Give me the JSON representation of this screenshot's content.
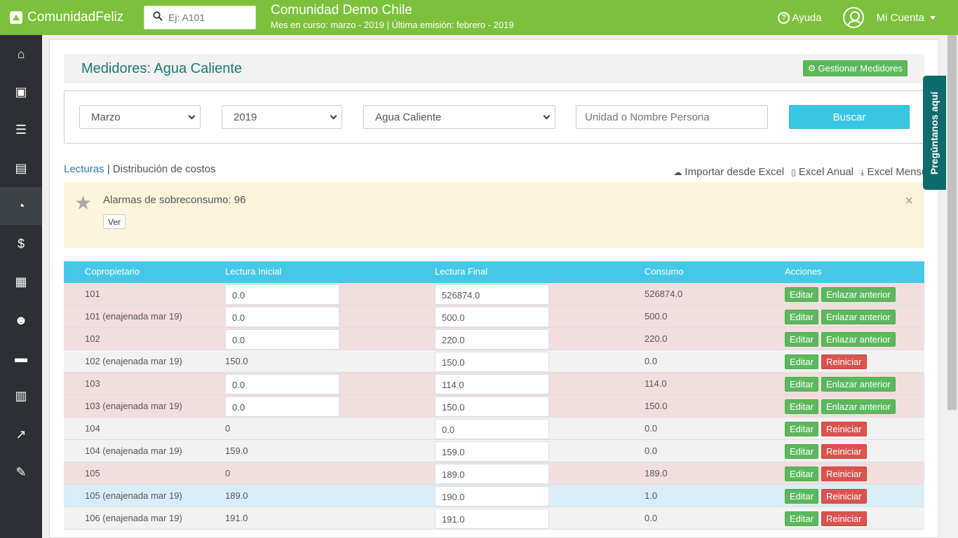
{
  "header": {
    "logo": "ComunidadFeliz",
    "search_placeholder": "Ej: A101",
    "community_name": "Comunidad Demo Chile",
    "community_sub": "Mes en curso: marzo - 2019 | Última emisión: febrero - 2019",
    "help": "Ayuda",
    "account": "Mi Cuenta"
  },
  "sidebar": {
    "icons": [
      "home-icon",
      "money-icon",
      "document-icon",
      "book-icon",
      "dashboard-icon",
      "dollar-icon",
      "calculator-icon",
      "users-icon",
      "briefcase-icon",
      "building-icon",
      "chart-icon",
      "wrench-icon"
    ],
    "glyphs": [
      "⌂",
      "▣",
      "☰",
      "▤",
      "◔",
      "$",
      "▦",
      "☻",
      "▬",
      "▥",
      "↗",
      "✎"
    ]
  },
  "page": {
    "title": "Medidores: Agua Caliente",
    "manage_button": "Gestionar Medidores"
  },
  "filters": {
    "month": "Marzo",
    "year": "2019",
    "type": "Agua Caliente",
    "person_placeholder": "Unidad o Nombre Persona",
    "search_button": "Buscar"
  },
  "tabs": {
    "lecturas": "Lecturas",
    "separator": " | ",
    "distribucion": "Distribución de costos"
  },
  "actions": {
    "import": "Importar desde Excel",
    "excel_anual": "Excel Anual",
    "excel_mensual": "Excel Mensual"
  },
  "alert": {
    "message": "Alarmas de sobreconsumo: 96",
    "button": "Ver",
    "close": "×"
  },
  "table": {
    "headers": [
      "Copropietario",
      "Lectura Inicial",
      "Lectura Final",
      "Consumo",
      "Acciones"
    ],
    "edit_label": "Editar",
    "link_label": "Enlazar anterior",
    "reset_label": "Reiniciar",
    "rows": [
      {
        "owner": "101",
        "initial": "0.0",
        "final": "526874.0",
        "consumo": "526874.0"
      },
      {
        "owner": "101 (enajenada mar 19)",
        "initial": "0.0",
        "final": "500.0",
        "consumo": "500.0"
      },
      {
        "owner": "102",
        "initial": "0.0",
        "final": "220.0",
        "consumo": "220.0"
      },
      {
        "owner": "102 (enajenada mar 19)",
        "initial": "150.0",
        "final": "150.0",
        "consumo": "0.0"
      },
      {
        "owner": "103",
        "initial": "0.0",
        "final": "114.0",
        "consumo": "114.0"
      },
      {
        "owner": "103 (enajenada mar 19)",
        "initial": "0.0",
        "final": "150.0",
        "consumo": "150.0"
      },
      {
        "owner": "104",
        "initial": "0",
        "final": "0.0",
        "consumo": "0.0"
      },
      {
        "owner": "104 (enajenada mar 19)",
        "initial": "159.0",
        "final": "159.0",
        "consumo": "0.0"
      },
      {
        "owner": "105",
        "initial": "0",
        "final": "189.0",
        "consumo": "189.0"
      },
      {
        "owner": "105 (enajenada mar 19)",
        "initial": "189.0",
        "final": "190.0",
        "consumo": "1.0"
      },
      {
        "owner": "106 (enajenada mar 19)",
        "initial": "191.0",
        "final": "191.0",
        "consumo": "0.0"
      }
    ]
  },
  "feedback_tab": "Pregúntanos aquí"
}
